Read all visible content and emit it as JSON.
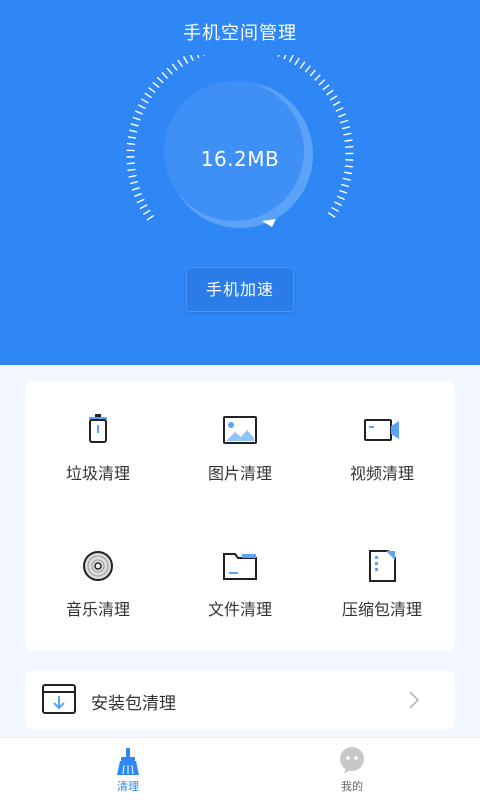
{
  "header": {
    "title": "手机空间管理"
  },
  "storage": {
    "value": "16.2MB"
  },
  "boost_button": {
    "label": "手机加速"
  },
  "categories": [
    {
      "label": "垃圾清理",
      "icon": "trash-icon"
    },
    {
      "label": "图片清理",
      "icon": "image-icon"
    },
    {
      "label": "视频清理",
      "icon": "video-icon"
    },
    {
      "label": "音乐清理",
      "icon": "music-disc-icon"
    },
    {
      "label": "文件清理",
      "icon": "folder-icon"
    },
    {
      "label": "压缩包清理",
      "icon": "zip-file-icon"
    }
  ],
  "apk_clean": {
    "label": "安装包清理",
    "icon": "apk-download-icon"
  },
  "tabbar": {
    "items": [
      {
        "label": "清理",
        "icon": "broom-icon",
        "active": true
      },
      {
        "label": "我的",
        "icon": "profile-icon",
        "active": false
      }
    ]
  },
  "colors": {
    "primary": "#2f87f6",
    "background": "#f3f8ff",
    "text": "#333333"
  }
}
